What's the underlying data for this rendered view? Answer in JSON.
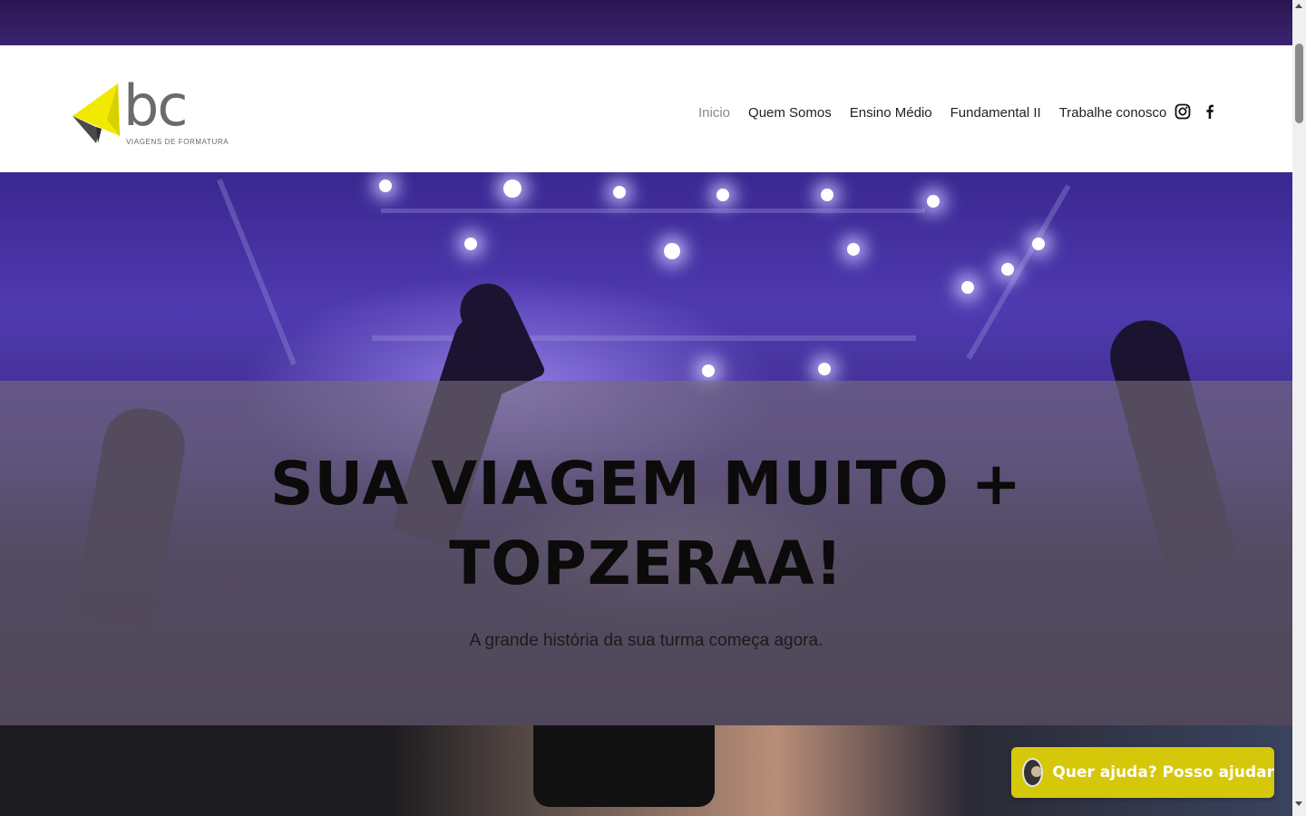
{
  "header": {
    "logo": {
      "word": "bc",
      "tagline": "VIAGENS DE FORMATURA"
    },
    "nav": [
      {
        "label": "Inicio",
        "active": true
      },
      {
        "label": "Quem Somos"
      },
      {
        "label": "Ensino Médio"
      },
      {
        "label": "Fundamental II"
      },
      {
        "label": "Trabalhe conosco"
      }
    ],
    "social": [
      "instagram-icon",
      "facebook-icon"
    ]
  },
  "hero": {
    "title_line1": "SUA VIAGEM MUITO +",
    "title_line2": "TOPZERAA!",
    "subtitle": "A grande história da sua turma começa agora."
  },
  "chat": {
    "label": "Quer ajuda? Posso ajudar"
  },
  "colors": {
    "accent": "#d5c80a",
    "logo_yellow": "#f2e900",
    "hero_purple": "#4f3ab0"
  }
}
